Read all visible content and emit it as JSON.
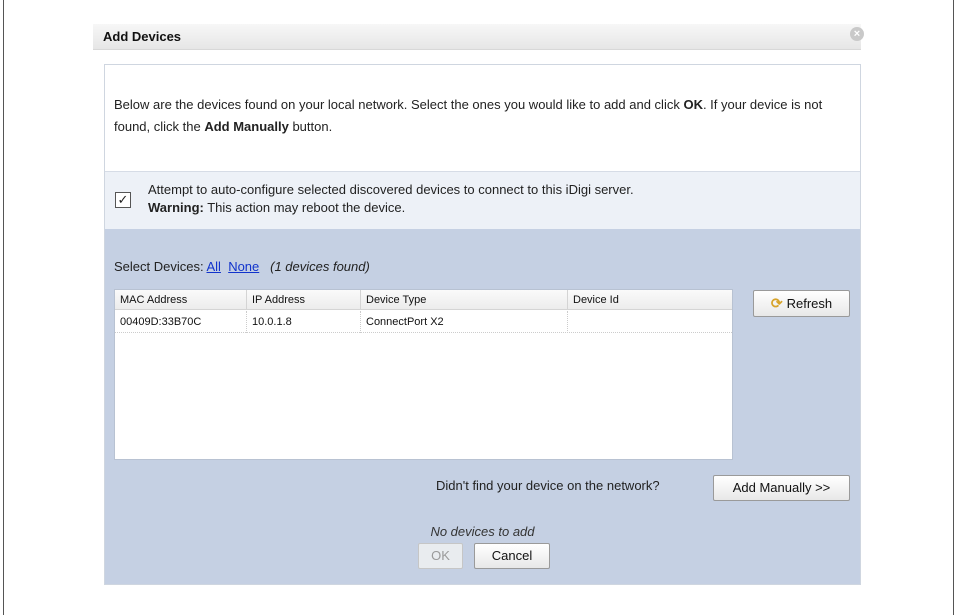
{
  "dialog": {
    "title": "Add Devices",
    "close_icon": "×"
  },
  "intro": {
    "text_1": "Below are the devices found on your local network. Select the ones you would like to add and click ",
    "ok_word": "OK",
    "text_2": ". If your device is not found, click the ",
    "add_manually_word": "Add Manually",
    "text_3": " button."
  },
  "autoconfigure": {
    "checked": true,
    "check_glyph": "✓",
    "line1": "Attempt to auto-configure selected discovered devices to connect to this iDigi server.",
    "warning_label": "Warning:",
    "warning_text": " This action may reboot the device."
  },
  "select": {
    "label": "Select Devices: ",
    "all_link": "All",
    "none_link": "None",
    "found_text": "(1 devices found)"
  },
  "table": {
    "columns": [
      "MAC Address",
      "IP Address",
      "Device Type",
      "Device Id"
    ],
    "rows": [
      [
        "00409D:33B70C",
        "10.0.1.8",
        "ConnectPort X2",
        ""
      ]
    ]
  },
  "refresh": {
    "label": "Refresh",
    "icon": "refresh-icon"
  },
  "not_found": {
    "text": "Didn't find your device on the network?",
    "button_label": "Add Manually >>"
  },
  "footer": {
    "status": "No devices to add",
    "ok_label": "OK",
    "ok_enabled": false,
    "cancel_label": "Cancel"
  }
}
